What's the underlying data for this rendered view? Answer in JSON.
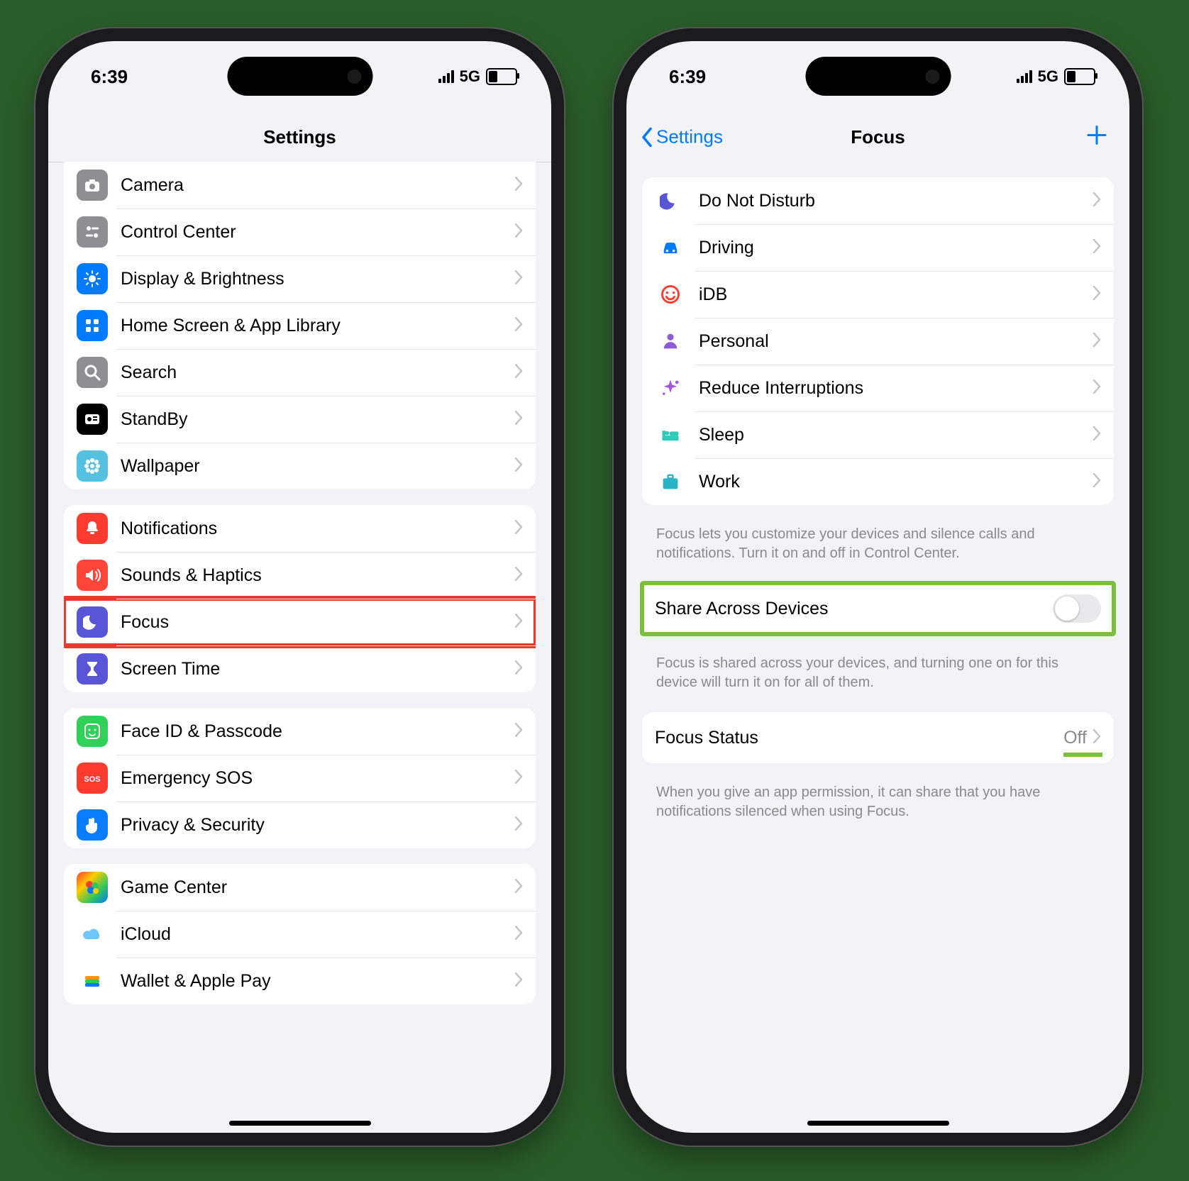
{
  "status": {
    "time": "6:39",
    "network": "5G"
  },
  "left": {
    "nav_title": "Settings",
    "groups": [
      {
        "rows": [
          {
            "id": "camera",
            "label": "Camera",
            "color": "bg-gray",
            "icon": "camera"
          },
          {
            "id": "control-center",
            "label": "Control Center",
            "color": "bg-gray",
            "icon": "sliders"
          },
          {
            "id": "display",
            "label": "Display & Brightness",
            "color": "bg-blue",
            "icon": "sun"
          },
          {
            "id": "home-screen",
            "label": "Home Screen & App Library",
            "color": "bg-blue",
            "icon": "grid"
          },
          {
            "id": "search",
            "label": "Search",
            "color": "bg-gray",
            "icon": "search"
          },
          {
            "id": "standby",
            "label": "StandBy",
            "color": "bg-black",
            "icon": "standby"
          },
          {
            "id": "wallpaper",
            "label": "Wallpaper",
            "color": "bg-teal",
            "icon": "flower"
          }
        ]
      },
      {
        "rows": [
          {
            "id": "notifications",
            "label": "Notifications",
            "color": "bg-red",
            "icon": "bell"
          },
          {
            "id": "sounds",
            "label": "Sounds & Haptics",
            "color": "bg-red2",
            "icon": "speaker"
          },
          {
            "id": "focus",
            "label": "Focus",
            "color": "bg-indigo",
            "icon": "moon",
            "highlight": "red"
          },
          {
            "id": "screen-time",
            "label": "Screen Time",
            "color": "bg-indigo",
            "icon": "hourglass"
          }
        ]
      },
      {
        "rows": [
          {
            "id": "face-id",
            "label": "Face ID & Passcode",
            "color": "bg-green",
            "icon": "face"
          },
          {
            "id": "sos",
            "label": "Emergency SOS",
            "color": "bg-red",
            "icon": "sos"
          },
          {
            "id": "privacy",
            "label": "Privacy & Security",
            "color": "bg-darkblue",
            "icon": "hand"
          }
        ]
      },
      {
        "rows": [
          {
            "id": "game-center",
            "label": "Game Center",
            "color": "bg-multi",
            "icon": "bubbles"
          },
          {
            "id": "icloud",
            "label": "iCloud",
            "color": "",
            "icon": "cloud"
          },
          {
            "id": "wallet",
            "label": "Wallet & Apple Pay",
            "color": "",
            "icon": "wallet"
          }
        ]
      }
    ]
  },
  "right": {
    "back_label": "Settings",
    "nav_title": "Focus",
    "modes": [
      {
        "id": "dnd",
        "label": "Do Not Disturb",
        "color": "#5856d6",
        "icon": "moon"
      },
      {
        "id": "driving",
        "label": "Driving",
        "color": "#007aff",
        "icon": "car"
      },
      {
        "id": "idb",
        "label": "iDB",
        "color": "#ff3b30",
        "icon": "smile"
      },
      {
        "id": "personal",
        "label": "Personal",
        "color": "#8e5bd6",
        "icon": "person"
      },
      {
        "id": "reduce",
        "label": "Reduce Interruptions",
        "color": "#a259d9",
        "icon": "sparkle"
      },
      {
        "id": "sleep",
        "label": "Sleep",
        "color": "#2fc9b8",
        "icon": "bed"
      },
      {
        "id": "work",
        "label": "Work",
        "color": "#28b4c4",
        "icon": "briefcase"
      }
    ],
    "modes_footer": "Focus lets you customize your devices and silence calls and notifications. Turn it on and off in Control Center.",
    "share_label": "Share Across Devices",
    "share_on": false,
    "share_footer": "Focus is shared across your devices, and turning one on for this device will turn it on for all of them.",
    "status_label": "Focus Status",
    "status_value": "Off",
    "status_footer": "When you give an app permission, it can share that you have notifications silenced when using Focus."
  }
}
